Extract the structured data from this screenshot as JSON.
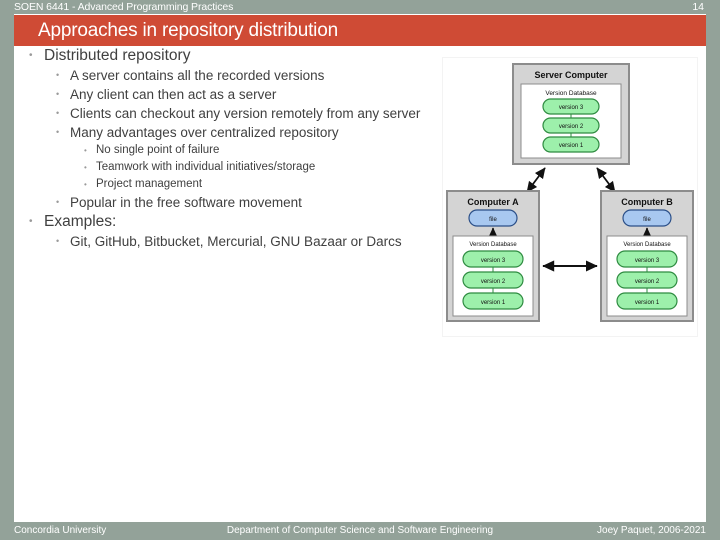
{
  "header": {
    "course": "SOEN 6441 - Advanced Programming Practices",
    "slide_number": "14"
  },
  "title": "Approaches in repository distribution",
  "colors": {
    "accent_red": "#cf4b35",
    "frame_green": "#93a299",
    "body_text": "#404040",
    "bullet_gray": "#9a9a9a",
    "node_green_fill": "#9df0ab",
    "node_green_stroke": "#2e8b40",
    "node_blue_fill": "#a8c8f0",
    "node_blue_stroke": "#2b4f88",
    "box_gray_fill": "#d4d4d4",
    "box_gray_stroke": "#808080"
  },
  "bullets": [
    {
      "level": 1,
      "text": "Distributed repository"
    },
    {
      "level": 2,
      "text": "A server contains all the recorded versions"
    },
    {
      "level": 2,
      "text": "Any client can then act as a server"
    },
    {
      "level": 2,
      "text": "Clients can checkout any version remotely from any server"
    },
    {
      "level": 2,
      "text": "Many advantages over centralized repository"
    },
    {
      "level": 3,
      "text": "No single point of failure"
    },
    {
      "level": 3,
      "text": "Teamwork with individual initiatives/storage"
    },
    {
      "level": 3,
      "text": "Project management"
    },
    {
      "level": 2,
      "text": "Popular in the free software movement"
    },
    {
      "level": 1,
      "text": "Examples:"
    },
    {
      "level": 2,
      "text": "Git, GitHub, Bitbucket, Mercurial, GNU Bazaar or Darcs"
    }
  ],
  "diagram": {
    "alt": "Distributed version control diagram",
    "server": {
      "title": "Server Computer",
      "db_label": "Version Database",
      "versions": [
        "version 3",
        "version 2",
        "version 1"
      ]
    },
    "computer_a": {
      "title": "Computer A",
      "file_label": "file",
      "db_label": "Version Database",
      "versions": [
        "version 3",
        "version 2",
        "version 1"
      ]
    },
    "computer_b": {
      "title": "Computer B",
      "file_label": "file",
      "db_label": "Version Database",
      "versions": [
        "version 3",
        "version 2",
        "version 1"
      ]
    }
  },
  "footer": {
    "left": "Concordia University",
    "center": "Department of Computer Science and Software Engineering",
    "right": "Joey Paquet, 2006-2021"
  }
}
